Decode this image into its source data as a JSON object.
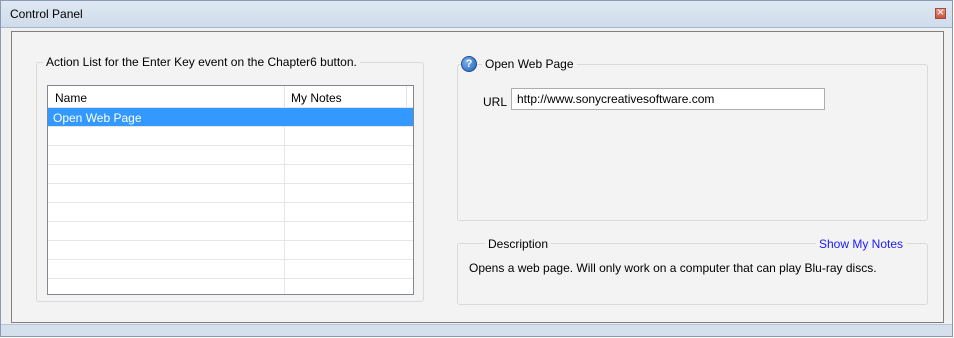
{
  "window": {
    "title": "Control Panel",
    "close_glyph": "×"
  },
  "action_list": {
    "legend": "Action List for the Enter Key event on the Chapter6 button.",
    "columns": [
      "Name",
      "My Notes"
    ],
    "rows": [
      {
        "name": "Open Web Page",
        "notes": "",
        "selected": true
      }
    ],
    "empty_rows": 9
  },
  "action_panel": {
    "icon": "help-icon",
    "title": "Open Web Page",
    "url_label": "URL",
    "url_value": "http://www.sonycreativesoftware.com"
  },
  "description": {
    "label": "Description",
    "notes_link": "Show My Notes",
    "text": "Opens a web page.  Will only work on a computer that can play Blu-ray discs."
  },
  "colors": {
    "selection": "#3399ff",
    "link": "#1a1aff"
  }
}
